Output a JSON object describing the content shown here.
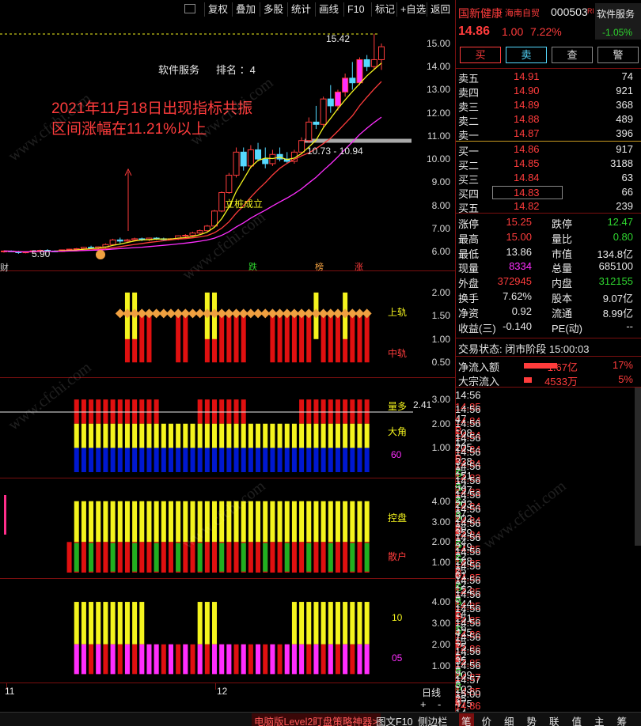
{
  "toolbar": [
    "复权",
    "叠加",
    "多股",
    "统计",
    "画线",
    "F10",
    "标记",
    "+自选",
    "返回"
  ],
  "header": {
    "name": "国新健康",
    "tag": "海南自贸",
    "code": "000503",
    "rtag": "Rl",
    "sector": "软件服务",
    "price": "14.86",
    "change": "1.00",
    "pct": "7.22%",
    "sector_pct": "-1.05%"
  },
  "actions": [
    "买",
    "卖",
    "查",
    "警"
  ],
  "asks": [
    {
      "label": "卖五",
      "price": "14.91",
      "vol": "74"
    },
    {
      "label": "卖四",
      "price": "14.90",
      "vol": "921"
    },
    {
      "label": "卖三",
      "price": "14.89",
      "vol": "368"
    },
    {
      "label": "卖二",
      "price": "14.88",
      "vol": "489"
    },
    {
      "label": "卖一",
      "price": "14.87",
      "vol": "396"
    }
  ],
  "bids": [
    {
      "label": "买一",
      "price": "14.86",
      "vol": "917"
    },
    {
      "label": "买二",
      "price": "14.85",
      "vol": "3188"
    },
    {
      "label": "买三",
      "price": "14.84",
      "vol": "63"
    },
    {
      "label": "买四",
      "price": "14.83",
      "vol": "66"
    },
    {
      "label": "买五",
      "price": "14.82",
      "vol": "239"
    }
  ],
  "stats": [
    {
      "k1": "涨停",
      "v1": "15.25",
      "c1": "red",
      "k2": "跌停",
      "v2": "12.47",
      "c2": "green"
    },
    {
      "k1": "最高",
      "v1": "15.00",
      "c1": "red",
      "k2": "量比",
      "v2": "0.80",
      "c2": "green"
    },
    {
      "k1": "最低",
      "v1": "13.86",
      "c1": "white",
      "k2": "市值",
      "v2": "134.8亿",
      "c2": "white"
    },
    {
      "k1": "现量",
      "v1": "8334",
      "c1": "mag",
      "k2": "总量",
      "v2": "685100",
      "c2": "white"
    },
    {
      "k1": "外盘",
      "v1": "372945",
      "c1": "red",
      "k2": "内盘",
      "v2": "312155",
      "c2": "green"
    },
    {
      "k1": "换手",
      "v1": "7.62%",
      "c1": "white",
      "k2": "股本",
      "v2": "9.07亿",
      "c2": "white"
    },
    {
      "k1": "净资",
      "v1": "0.92",
      "c1": "white",
      "k2": "流通",
      "v2": "8.99亿",
      "c2": "white"
    },
    {
      "k1": "收益(三)",
      "v1": "-0.140",
      "c1": "white",
      "k2": "PE(动)",
      "v2": "--",
      "c2": "white"
    }
  ],
  "status": "交易状态: 闭市阶段 15:00:03",
  "flows": [
    {
      "k": "净流入额",
      "v": "1.67亿",
      "p": "17%"
    },
    {
      "k": "大宗流入",
      "v": "4533万",
      "p": "5%"
    }
  ],
  "ticks": [
    [
      "14:56",
      "14.85",
      "47",
      "B",
      "12"
    ],
    [
      "14:56",
      "14.84",
      "108",
      "",
      ""
    ],
    [
      "14:56",
      "14.84",
      "205",
      "B",
      "25"
    ],
    [
      "14:56",
      "14.84",
      "338",
      "S",
      "43"
    ],
    [
      "14:56",
      "14.84",
      "151",
      "S",
      "23"
    ],
    [
      "14:56",
      "14.83",
      "297",
      "S",
      "37"
    ],
    [
      "14:56",
      "14.83",
      "203",
      "S",
      "26"
    ],
    [
      "14:56",
      "14.84",
      "202",
      "B",
      "24"
    ],
    [
      "14:56",
      "14.84",
      "359",
      "S",
      "22"
    ],
    [
      "14:56",
      "14.84",
      "219",
      "S",
      "25"
    ],
    [
      "14:56",
      "14.85",
      "188",
      "B",
      "22"
    ],
    [
      "14:56",
      "14.85",
      "61",
      "S",
      "8"
    ],
    [
      "14:56",
      "14.85",
      "152",
      "S",
      "14"
    ],
    [
      "14:56",
      "14.85",
      "144",
      "B",
      "16"
    ],
    [
      "14:56",
      "14.85",
      "151",
      "S",
      "15"
    ],
    [
      "14:56",
      "14.85",
      "425",
      "B",
      "12"
    ],
    [
      "14:56",
      "14.86",
      "75",
      "B",
      "8"
    ],
    [
      "14:56",
      "14.86",
      "35",
      "S",
      "8"
    ],
    [
      "14:56",
      "14.85",
      "209",
      "S",
      "25"
    ],
    [
      "14:56",
      "14.87",
      "103",
      "B",
      "14"
    ],
    [
      "14:57",
      "14.85",
      "475",
      "S",
      "31"
    ],
    [
      "15:00",
      "14.86",
      "8334",
      "",
      "434"
    ]
  ],
  "bottom_tabs": [
    "笔",
    "价",
    "细",
    "势",
    "联",
    "值",
    "主",
    "筹"
  ],
  "bottom_left": [
    "电脑版Level2盯盘策略神器>",
    "图文F10",
    "侧边栏"
  ],
  "main_chart": {
    "sector": "软件服务",
    "rank": "排名 ：4",
    "annotation1": "2021年11月18日出现指标共振",
    "annotation2": "区间涨幅在11.21%以上",
    "range_label": "10.73 - 10.94",
    "high_label": "15.42",
    "low_label": "5.90",
    "pile_label": "立桩成立",
    "yticks": [
      "15.00",
      "14.00",
      "13.00",
      "12.00",
      "11.00",
      "10.00",
      "9.00",
      "8.00",
      "7.00",
      "6.00"
    ],
    "markers": [
      "财",
      "跌",
      "榜",
      "涨"
    ]
  },
  "panels": [
    {
      "ticks": [
        "2.00",
        "1.50",
        "1.00",
        "0.50"
      ],
      "labels": [
        "上轨",
        "中轨"
      ]
    },
    {
      "ticks": [
        "3.00",
        "2.00",
        "1.00"
      ],
      "labels": [
        "量多",
        "大角",
        "60"
      ],
      "value": "2.41"
    },
    {
      "ticks": [
        "4.00",
        "3.00",
        "2.00",
        "1.00"
      ],
      "labels": [
        "控盘",
        "散户"
      ]
    },
    {
      "ticks": [
        "4.00",
        "3.00",
        "2.00",
        "1.00"
      ],
      "labels": [
        "10",
        "05"
      ]
    }
  ],
  "xaxis": [
    "11",
    "12"
  ],
  "xaxis_right": "日线",
  "zoom": [
    "+",
    "-"
  ],
  "watermark": "www.cfchi.com",
  "candles": [
    [
      6.0,
      6.05,
      5.95,
      6.02
    ],
    [
      6.02,
      6.05,
      5.98,
      6.0
    ],
    [
      6.0,
      6.03,
      5.9,
      5.95
    ],
    [
      5.95,
      6.0,
      5.92,
      5.98
    ],
    [
      5.98,
      6.05,
      5.95,
      6.03
    ],
    [
      6.03,
      6.08,
      6.0,
      6.05
    ],
    [
      6.05,
      6.1,
      6.0,
      6.02
    ],
    [
      6.02,
      6.05,
      5.97,
      6.0
    ],
    [
      6.0,
      6.08,
      5.98,
      6.07
    ],
    [
      6.07,
      6.12,
      6.02,
      6.1
    ],
    [
      6.1,
      6.15,
      6.05,
      6.12
    ],
    [
      6.12,
      6.2,
      6.08,
      6.18
    ],
    [
      6.18,
      6.25,
      6.1,
      6.15
    ],
    [
      6.15,
      6.22,
      6.1,
      6.2
    ],
    [
      6.2,
      6.35,
      6.15,
      6.3
    ],
    [
      6.3,
      6.55,
      6.25,
      6.5
    ],
    [
      6.5,
      6.6,
      6.35,
      6.45
    ],
    [
      6.45,
      6.55,
      6.4,
      6.5
    ],
    [
      6.5,
      6.6,
      6.45,
      6.55
    ],
    [
      6.55,
      6.6,
      6.45,
      6.5
    ],
    [
      6.5,
      6.6,
      6.45,
      6.58
    ],
    [
      6.58,
      6.62,
      6.5,
      6.55
    ],
    [
      6.55,
      6.6,
      6.48,
      6.52
    ],
    [
      6.52,
      6.58,
      6.48,
      6.55
    ],
    [
      6.55,
      6.7,
      6.5,
      6.68
    ],
    [
      6.68,
      6.75,
      6.6,
      6.7
    ],
    [
      6.7,
      6.85,
      6.65,
      6.8
    ],
    [
      6.8,
      6.95,
      6.75,
      6.9
    ],
    [
      6.9,
      7.15,
      6.85,
      7.1
    ],
    [
      7.1,
      7.8,
      7.05,
      7.75
    ],
    [
      7.75,
      8.6,
      7.7,
      8.55
    ],
    [
      8.55,
      9.4,
      8.5,
      9.3
    ],
    [
      9.3,
      10.5,
      9.2,
      10.3
    ],
    [
      10.3,
      10.5,
      9.5,
      9.7
    ],
    [
      9.7,
      10.6,
      9.6,
      10.4
    ],
    [
      10.4,
      10.7,
      9.9,
      10.0
    ],
    [
      10.0,
      10.5,
      9.6,
      9.8
    ],
    [
      9.8,
      10.4,
      9.7,
      10.2
    ],
    [
      10.2,
      10.5,
      9.9,
      10.0
    ],
    [
      10.0,
      10.3,
      9.8,
      9.9
    ],
    [
      9.9,
      10.4,
      9.8,
      10.3
    ],
    [
      10.3,
      10.94,
      10.2,
      10.8
    ],
    [
      10.8,
      11.8,
      10.7,
      11.6
    ],
    [
      11.6,
      12.3,
      11.3,
      11.5
    ],
    [
      11.5,
      12.7,
      11.4,
      12.6
    ],
    [
      12.6,
      13.2,
      12.0,
      12.3
    ],
    [
      12.3,
      13.0,
      12.1,
      12.9
    ],
    [
      12.9,
      13.7,
      12.7,
      13.5
    ],
    [
      13.5,
      14.2,
      13.0,
      13.3
    ],
    [
      13.3,
      14.4,
      13.2,
      14.3
    ],
    [
      14.3,
      14.5,
      13.8,
      14.0
    ],
    [
      14.0,
      15.42,
      13.86,
      14.3
    ],
    [
      14.3,
      15.0,
      13.86,
      14.86
    ]
  ]
}
